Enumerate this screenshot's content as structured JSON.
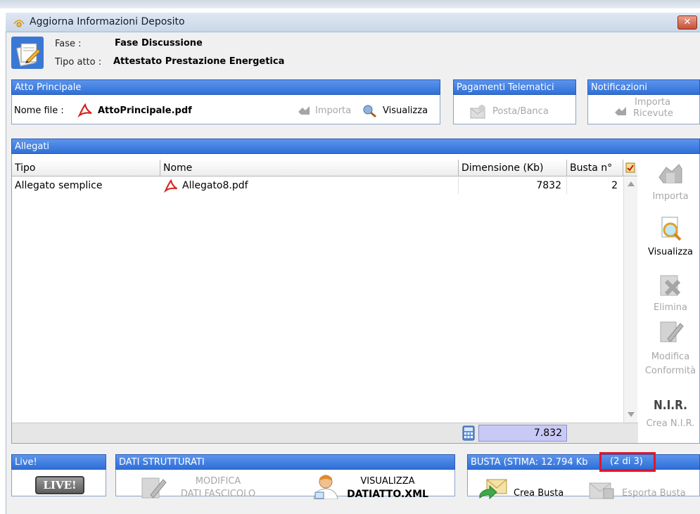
{
  "window": {
    "title": "Aggiorna Informazioni Deposito",
    "close_label": "✕"
  },
  "info": {
    "fase_label": "Fase :",
    "fase_value": "Fase Discussione",
    "tipo_label": "Tipo atto :",
    "tipo_value": "Attestato Prestazione Energetica"
  },
  "atto_principale": {
    "header": "Atto Principale",
    "nome_file_label": "Nome file :",
    "nome_file_value": "AttoPrincipale.pdf",
    "importa_label": "Importa",
    "visualizza_label": "Visualizza"
  },
  "pagamenti": {
    "header": "Pagamenti Telematici",
    "posta_banca_label": "Posta/Banca"
  },
  "notificazioni": {
    "header": "Notificazioni",
    "importa_ricevute_line1": "Importa",
    "importa_ricevute_line2": "Ricevute"
  },
  "allegati": {
    "header": "Allegati",
    "columns": {
      "tipo": "Tipo",
      "nome": "Nome",
      "dimensione": "Dimensione (Kb)",
      "busta": "Busta n°"
    },
    "rows": [
      {
        "tipo": "Allegato semplice",
        "nome": "Allegato8.pdf",
        "dimensione": "7832",
        "busta": "2"
      }
    ],
    "total": "7.832"
  },
  "side_actions": {
    "importa": "Importa",
    "visualizza": "Visualizza",
    "elimina": "Elimina",
    "modifica_line1": "Modifica",
    "modifica_line2": "Conformità",
    "nir_icon_text": "N.I.R.",
    "crea_nir": "Crea N.I.R."
  },
  "live": {
    "header": "Live!",
    "badge": "LIVE!"
  },
  "dati_strutturati": {
    "header": "DATI STRUTTURATI",
    "modifica_line1": "MODIFICA",
    "modifica_line2": "DATI FASCICOLO",
    "visualizza_line1": "VISUALIZZA",
    "visualizza_line2": "DATIATTO.XML"
  },
  "busta": {
    "header": "BUSTA (STIMA: 12.794 Kb",
    "count": "(2 di 3)",
    "crea_label": "Crea Busta",
    "esporta_label": "Esporta Busta"
  },
  "colors": {
    "header_blue": "#3f7fe3",
    "highlight_red": "#e0162b",
    "disabled_gray": "#a7a7a7",
    "total_cell": "#c9c9f5"
  }
}
